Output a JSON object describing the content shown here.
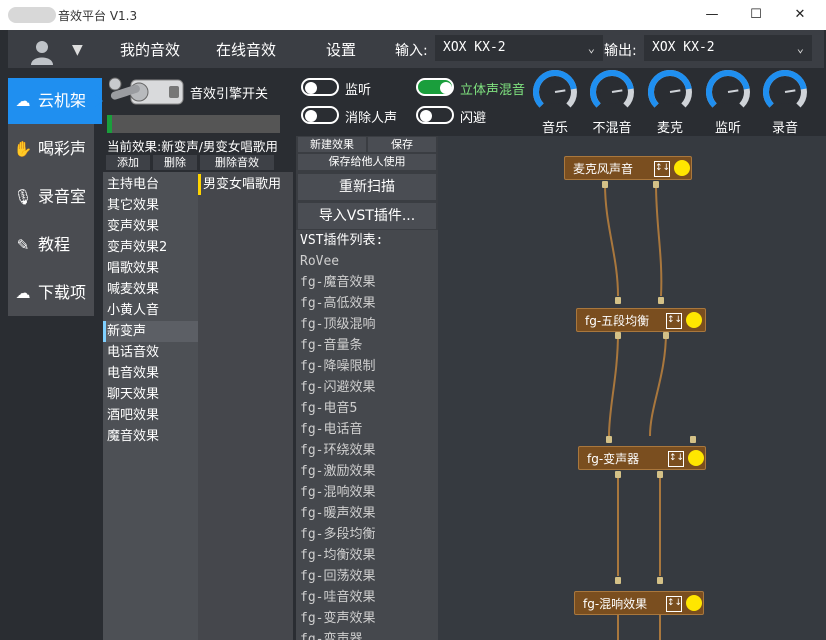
{
  "window": {
    "title": "音效平台 V1.3",
    "minimize": "—",
    "maximize": "☐",
    "close": "✕"
  },
  "menu": {
    "user_dropdown": "▼",
    "items": [
      "我的音效",
      "在线音效",
      "设置"
    ],
    "input_label": "输入:",
    "input_value": "XOX KX-2",
    "output_label": "输出:",
    "output_value": "XOX KX-2"
  },
  "sidebar": {
    "items": [
      {
        "label": "云机架",
        "icon": "cloud-icon",
        "glyph": "☁",
        "active": true
      },
      {
        "label": "喝彩声",
        "icon": "clap-icon",
        "glyph": "✋",
        "active": false
      },
      {
        "label": "录音室",
        "icon": "microphone-icon",
        "glyph": "🎙",
        "active": false
      },
      {
        "label": "教程",
        "icon": "tutorial-icon",
        "glyph": "✎",
        "active": false
      },
      {
        "label": "下载项",
        "icon": "cloud-download-icon",
        "glyph": "☁",
        "active": false
      }
    ]
  },
  "engine": {
    "label": "音效引擎开关",
    "meter_level": 0.03
  },
  "toggles": [
    {
      "label": "监听",
      "on": false
    },
    {
      "label": "立体声混音",
      "on": true
    },
    {
      "label": "消除人声",
      "on": false
    },
    {
      "label": "闪避",
      "on": false
    }
  ],
  "knobs": [
    {
      "label": "音乐",
      "level": 0.8
    },
    {
      "label": "不混音",
      "level": 0.8
    },
    {
      "label": "麦克",
      "level": 0.8
    },
    {
      "label": "监听",
      "level": 0.8
    },
    {
      "label": "录音",
      "level": 0.8
    }
  ],
  "current_effect": "当前效果:新变声/男变女唱歌用",
  "effect_buttons": [
    "添加",
    "删除",
    "删除音效"
  ],
  "categories": [
    "主持电台",
    "其它效果",
    "变声效果",
    "变声效果2",
    "唱歌效果",
    "喊麦效果",
    "小黄人音",
    "新变声",
    "电话音效",
    "电音效果",
    "聊天效果",
    "酒吧效果",
    "魔音效果"
  ],
  "selected_category": "新变声",
  "sub_effects": [
    "男变女唱歌用"
  ],
  "vst": {
    "new_effect": "新建效果",
    "save": "保存",
    "save_for_others": "保存给他人使用",
    "rescan": "重新扫描",
    "import": "导入VST插件...",
    "list_header": "VST插件列表:",
    "plugins": [
      "RoVee",
      "fg-魔音效果",
      "fg-高低效果",
      "fg-顶级混响",
      "fg-音量条",
      "fg-降噪限制",
      "fg-闪避效果",
      "fg-电音5",
      "fg-电话音",
      "fg-环绕效果",
      "fg-激励效果",
      "fg-混响效果",
      "fg-暖声效果",
      "fg-多段均衡",
      "fg-均衡效果",
      "fg-回荡效果",
      "fg-哇音效果",
      "fg-变声效果",
      "fg-变声器"
    ]
  },
  "graph": {
    "nodes": [
      {
        "label": "麦克风声音",
        "icon": "↕↓"
      },
      {
        "label": "fg-五段均衡",
        "icon": "↕↓"
      },
      {
        "label": "fg-变声器",
        "icon": "↕↓"
      },
      {
        "label": "fg-混响效果",
        "icon": "↕↓"
      }
    ],
    "node_color": "#7a4e1f",
    "dot_color": "#ffe600",
    "accent": "#1f8ff0"
  }
}
